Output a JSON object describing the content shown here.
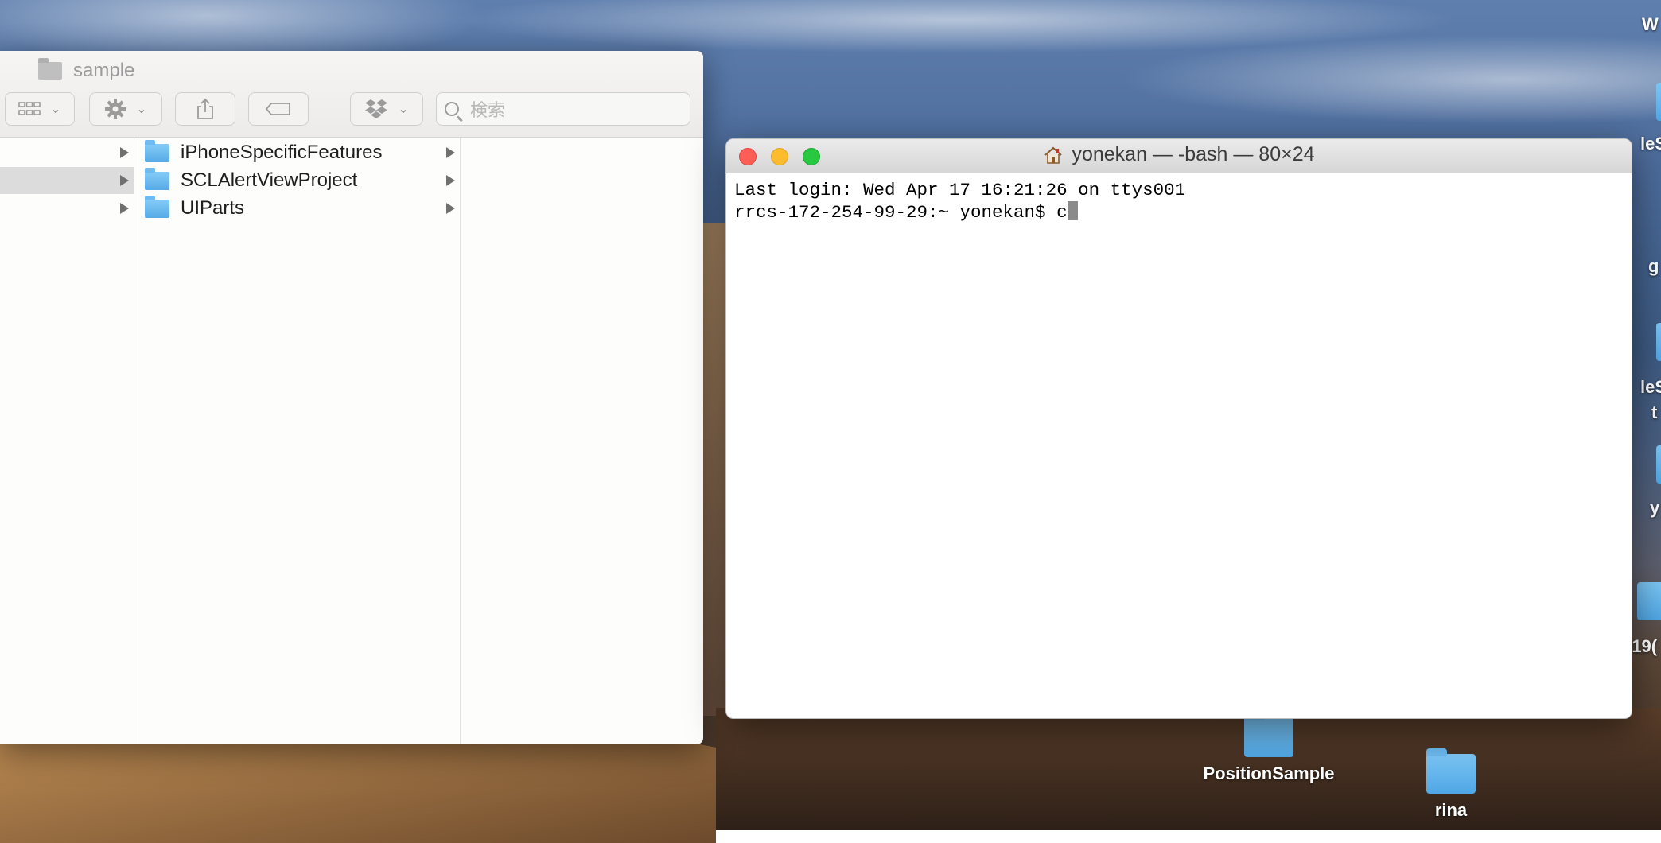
{
  "finder": {
    "title": "sample",
    "search_placeholder": "検索",
    "folders": [
      {
        "name": "iPhoneSpecificFeatures"
      },
      {
        "name": "SCLAlertViewProject"
      },
      {
        "name": "UIParts"
      }
    ],
    "icons": {
      "view": "icon-grid-icon",
      "action": "gear-icon",
      "share": "share-icon",
      "tag": "tag-icon",
      "dropbox": "dropbox-icon",
      "search": "search-icon"
    }
  },
  "terminal": {
    "title": "yonekan — -bash — 80×24",
    "lines": [
      "Last login: Wed Apr 17 16:21:26 on ttys001",
      "rrcs-172-254-99-29:~ yonekan$ c"
    ]
  },
  "desktop": {
    "items": [
      {
        "label": "PositionSample"
      },
      {
        "label": "rina"
      }
    ],
    "edge_labels": [
      "W",
      "leS",
      "g",
      "leS",
      "t",
      "y",
      ")19("
    ]
  },
  "colors": {
    "close": "#fd5e56",
    "minimize": "#fdbb2e",
    "zoom": "#28c840",
    "folder": "#56aae6"
  }
}
